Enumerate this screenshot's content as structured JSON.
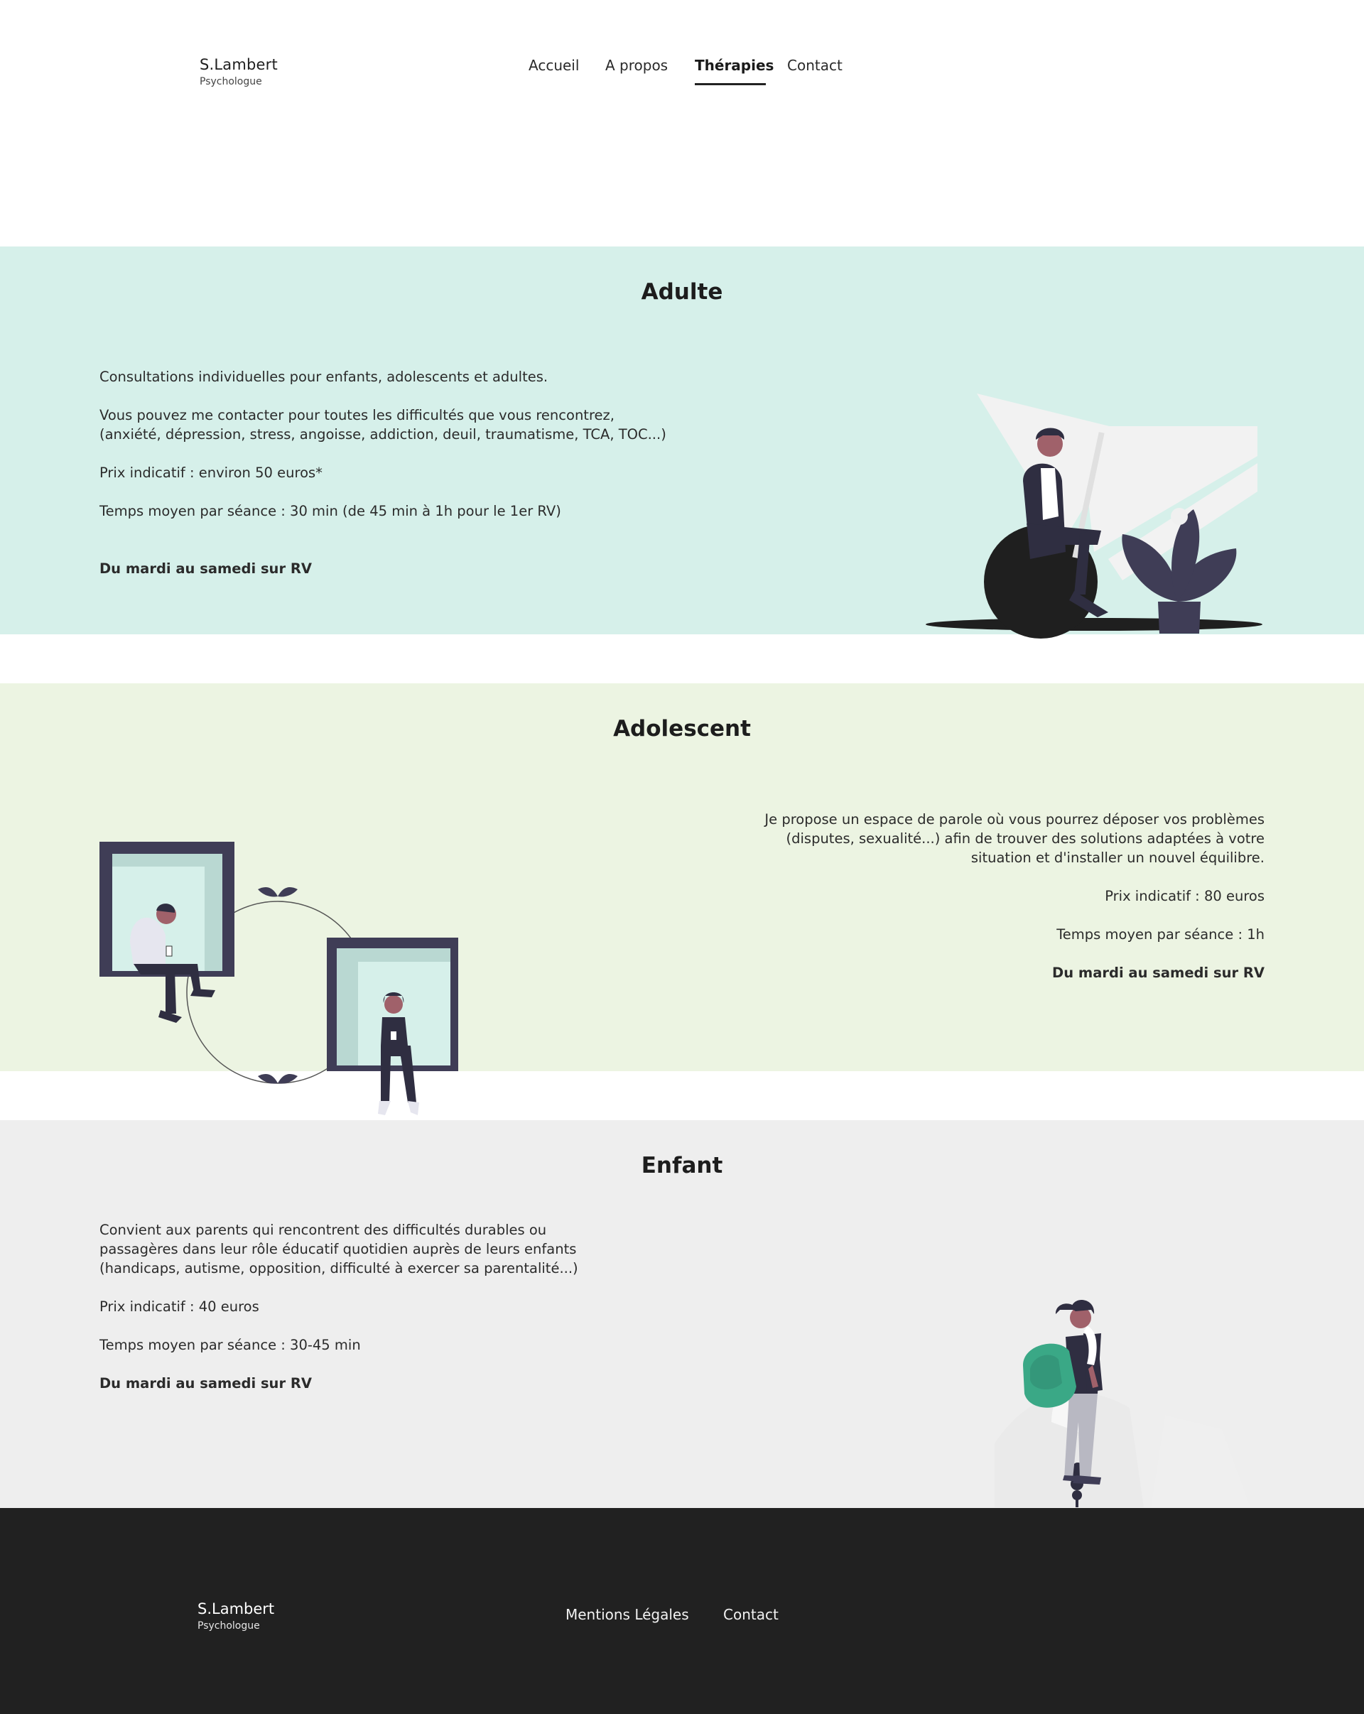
{
  "header": {
    "logo_name": "S.Lambert",
    "logo_sub": "Psychologue",
    "nav": [
      "Accueil",
      "A propos",
      "Thérapies",
      "Contact"
    ],
    "active_nav": "Thérapies"
  },
  "adult": {
    "title": "Adulte",
    "line1": "Consultations individuelles pour enfants, adolescents et adultes.",
    "line2a": "Vous pouvez me contacter pour toutes les difficultés que vous rencontrez,",
    "line2b": "(anxiété, dépression, stress, angoisse, addiction, deuil, traumatisme, TCA, TOC...)",
    "price": "Prix indicatif : environ 50 euros*",
    "duration": "Temps moyen par séance : 30 min (de 45 min à 1h pour le 1er RV)",
    "schedule": "Du mardi au samedi sur RV"
  },
  "ado": {
    "title": "Adolescent",
    "line1a": "Je propose un espace de parole où vous pourrez déposer vos problèmes",
    "line1b": "(disputes, sexualité...) afin de trouver des solutions adaptées à votre",
    "line1c": "situation et d'installer un nouvel équilibre.",
    "price": "Prix indicatif : 80 euros",
    "duration": "Temps moyen par séance : 1h",
    "schedule": "Du mardi au samedi sur RV"
  },
  "child": {
    "title": "Enfant",
    "line1a": "Convient aux parents qui rencontrent des difficultés  durables ou",
    "line1b": "passagères dans leur rôle éducatif quotidien auprès de leurs enfants",
    "line1c": "(handicaps, autisme, opposition, difficulté à exercer sa parentalité...)",
    "price": "Prix indicatif : 40 euros",
    "duration": "Temps moyen par séance : 30-45 min",
    "schedule": "Du mardi au samedi sur RV"
  },
  "footer": {
    "logo_name": "S.Lambert",
    "logo_sub": "Psychologue",
    "links": [
      "Mentions Légales",
      "Contact"
    ]
  },
  "colors": {
    "adult_bg": "#d6f0ea",
    "ado_bg": "#ecf4e2",
    "child_bg": "#eeeeee",
    "footer_bg": "#212121",
    "illustration_dark": "#3f3d56",
    "backpack": "#3aa886"
  }
}
